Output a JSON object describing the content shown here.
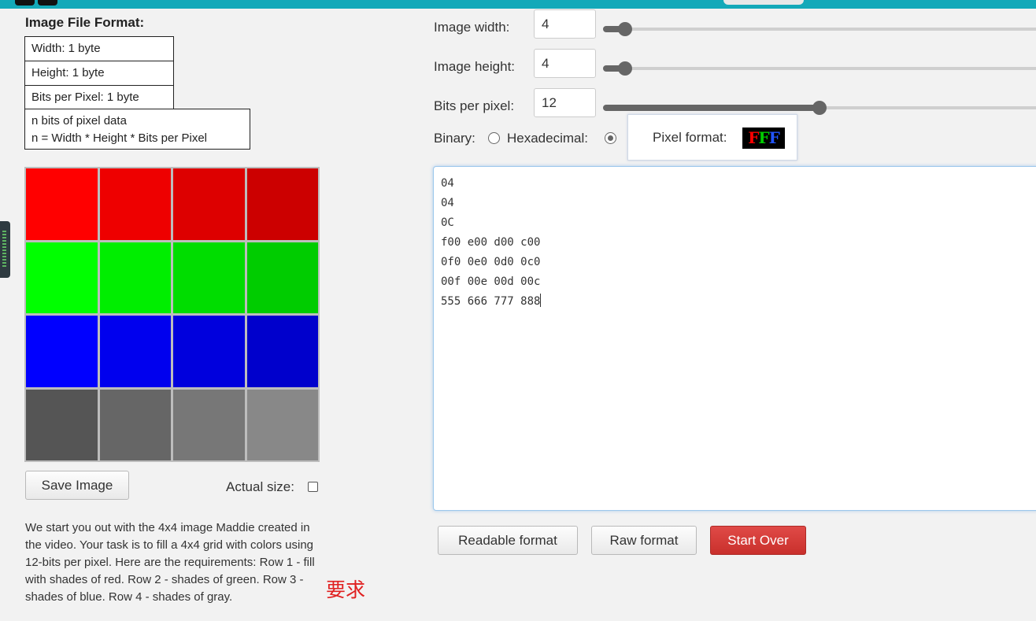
{
  "file_format": {
    "title": "Image File Format:",
    "width_row": "Width: 1 byte",
    "height_row": "Height: 1 byte",
    "bpp_row": "Bits per Pixel: 1 byte",
    "data_row_1": "n bits of pixel data",
    "data_row_2": "n = Width * Height * Bits per Pixel"
  },
  "pixel_grid": {
    "colors": [
      [
        "#ff0000",
        "#ee0000",
        "#dd0000",
        "#cc0000"
      ],
      [
        "#00ff00",
        "#00ee00",
        "#00dd00",
        "#00cc00"
      ],
      [
        "#0000ff",
        "#0000ee",
        "#0000dd",
        "#0000cc"
      ],
      [
        "#555555",
        "#666666",
        "#777777",
        "#888888"
      ]
    ]
  },
  "controls_left": {
    "save_label": "Save Image",
    "actual_size_label": "Actual size:"
  },
  "description": {
    "text": "We start you out with the 4x4 image Maddie created in the video. Your task is to fill a 4x4 grid with colors using 12-bits per pixel. Here are the requirements: Row 1 - fill with shades of red. Row 2 - shades of green. Row 3 - shades of blue. Row 4 - shades of gray."
  },
  "annotation": {
    "text": "要求"
  },
  "settings": {
    "width_label": "Image width:",
    "width_value": "4",
    "width_slider": {
      "min": 1,
      "max": 255,
      "value": 4
    },
    "height_label": "Image height:",
    "height_value": "4",
    "height_slider": {
      "min": 1,
      "max": 255,
      "value": 4
    },
    "bpp_label": "Bits per pixel:",
    "bpp_value": "12",
    "bpp_slider": {
      "min": 1,
      "max": 24,
      "value": 12
    },
    "binary_label": "Binary:",
    "hex_label": "Hexadecimal:",
    "selected_mode": "hexadecimal",
    "pixel_format_label": "Pixel format:",
    "pixel_format_chars": [
      "F",
      "F",
      "F"
    ],
    "pixel_format_colors": [
      "#ff0000",
      "#00cc00",
      "#2255ff"
    ]
  },
  "editor": {
    "lines": [
      "04",
      "04",
      "0C",
      "f00 e00 d00 c00",
      "0f0 0e0 0d0 0c0",
      "00f 00e 00d 00c",
      "555 666 777 888"
    ]
  },
  "actions": {
    "readable_label": "Readable format",
    "raw_label": "Raw format",
    "start_over_label": "Start Over"
  },
  "colors": {
    "topbar": "#14a9b9",
    "start_over": "#d9403c",
    "editor_focus": "#9cc7ec"
  }
}
